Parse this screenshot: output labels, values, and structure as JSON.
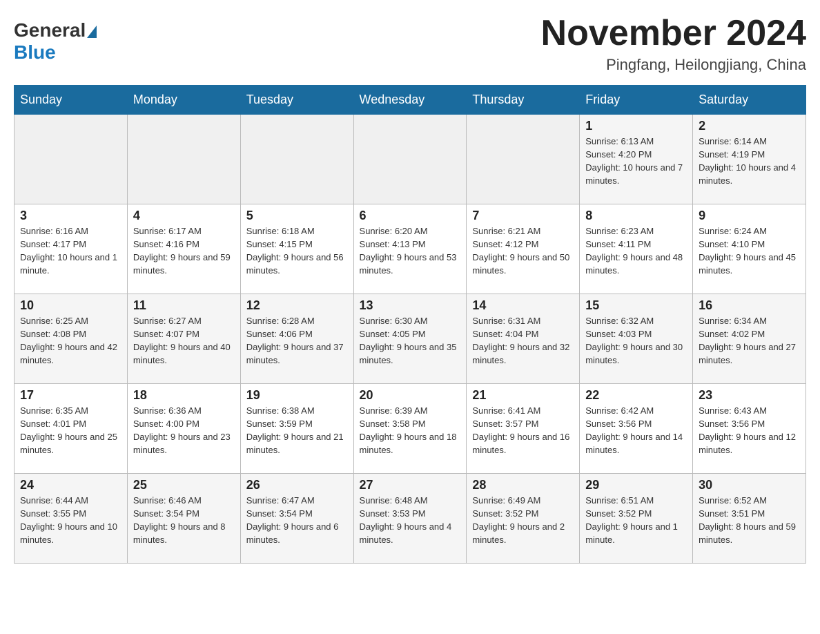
{
  "logo": {
    "general": "General",
    "blue": "Blue"
  },
  "title": "November 2024",
  "location": "Pingfang, Heilongjiang, China",
  "weekdays": [
    "Sunday",
    "Monday",
    "Tuesday",
    "Wednesday",
    "Thursday",
    "Friday",
    "Saturday"
  ],
  "weeks": [
    [
      {
        "day": "",
        "info": ""
      },
      {
        "day": "",
        "info": ""
      },
      {
        "day": "",
        "info": ""
      },
      {
        "day": "",
        "info": ""
      },
      {
        "day": "",
        "info": ""
      },
      {
        "day": "1",
        "info": "Sunrise: 6:13 AM\nSunset: 4:20 PM\nDaylight: 10 hours and 7 minutes."
      },
      {
        "day": "2",
        "info": "Sunrise: 6:14 AM\nSunset: 4:19 PM\nDaylight: 10 hours and 4 minutes."
      }
    ],
    [
      {
        "day": "3",
        "info": "Sunrise: 6:16 AM\nSunset: 4:17 PM\nDaylight: 10 hours and 1 minute."
      },
      {
        "day": "4",
        "info": "Sunrise: 6:17 AM\nSunset: 4:16 PM\nDaylight: 9 hours and 59 minutes."
      },
      {
        "day": "5",
        "info": "Sunrise: 6:18 AM\nSunset: 4:15 PM\nDaylight: 9 hours and 56 minutes."
      },
      {
        "day": "6",
        "info": "Sunrise: 6:20 AM\nSunset: 4:13 PM\nDaylight: 9 hours and 53 minutes."
      },
      {
        "day": "7",
        "info": "Sunrise: 6:21 AM\nSunset: 4:12 PM\nDaylight: 9 hours and 50 minutes."
      },
      {
        "day": "8",
        "info": "Sunrise: 6:23 AM\nSunset: 4:11 PM\nDaylight: 9 hours and 48 minutes."
      },
      {
        "day": "9",
        "info": "Sunrise: 6:24 AM\nSunset: 4:10 PM\nDaylight: 9 hours and 45 minutes."
      }
    ],
    [
      {
        "day": "10",
        "info": "Sunrise: 6:25 AM\nSunset: 4:08 PM\nDaylight: 9 hours and 42 minutes."
      },
      {
        "day": "11",
        "info": "Sunrise: 6:27 AM\nSunset: 4:07 PM\nDaylight: 9 hours and 40 minutes."
      },
      {
        "day": "12",
        "info": "Sunrise: 6:28 AM\nSunset: 4:06 PM\nDaylight: 9 hours and 37 minutes."
      },
      {
        "day": "13",
        "info": "Sunrise: 6:30 AM\nSunset: 4:05 PM\nDaylight: 9 hours and 35 minutes."
      },
      {
        "day": "14",
        "info": "Sunrise: 6:31 AM\nSunset: 4:04 PM\nDaylight: 9 hours and 32 minutes."
      },
      {
        "day": "15",
        "info": "Sunrise: 6:32 AM\nSunset: 4:03 PM\nDaylight: 9 hours and 30 minutes."
      },
      {
        "day": "16",
        "info": "Sunrise: 6:34 AM\nSunset: 4:02 PM\nDaylight: 9 hours and 27 minutes."
      }
    ],
    [
      {
        "day": "17",
        "info": "Sunrise: 6:35 AM\nSunset: 4:01 PM\nDaylight: 9 hours and 25 minutes."
      },
      {
        "day": "18",
        "info": "Sunrise: 6:36 AM\nSunset: 4:00 PM\nDaylight: 9 hours and 23 minutes."
      },
      {
        "day": "19",
        "info": "Sunrise: 6:38 AM\nSunset: 3:59 PM\nDaylight: 9 hours and 21 minutes."
      },
      {
        "day": "20",
        "info": "Sunrise: 6:39 AM\nSunset: 3:58 PM\nDaylight: 9 hours and 18 minutes."
      },
      {
        "day": "21",
        "info": "Sunrise: 6:41 AM\nSunset: 3:57 PM\nDaylight: 9 hours and 16 minutes."
      },
      {
        "day": "22",
        "info": "Sunrise: 6:42 AM\nSunset: 3:56 PM\nDaylight: 9 hours and 14 minutes."
      },
      {
        "day": "23",
        "info": "Sunrise: 6:43 AM\nSunset: 3:56 PM\nDaylight: 9 hours and 12 minutes."
      }
    ],
    [
      {
        "day": "24",
        "info": "Sunrise: 6:44 AM\nSunset: 3:55 PM\nDaylight: 9 hours and 10 minutes."
      },
      {
        "day": "25",
        "info": "Sunrise: 6:46 AM\nSunset: 3:54 PM\nDaylight: 9 hours and 8 minutes."
      },
      {
        "day": "26",
        "info": "Sunrise: 6:47 AM\nSunset: 3:54 PM\nDaylight: 9 hours and 6 minutes."
      },
      {
        "day": "27",
        "info": "Sunrise: 6:48 AM\nSunset: 3:53 PM\nDaylight: 9 hours and 4 minutes."
      },
      {
        "day": "28",
        "info": "Sunrise: 6:49 AM\nSunset: 3:52 PM\nDaylight: 9 hours and 2 minutes."
      },
      {
        "day": "29",
        "info": "Sunrise: 6:51 AM\nSunset: 3:52 PM\nDaylight: 9 hours and 1 minute."
      },
      {
        "day": "30",
        "info": "Sunrise: 6:52 AM\nSunset: 3:51 PM\nDaylight: 8 hours and 59 minutes."
      }
    ]
  ]
}
